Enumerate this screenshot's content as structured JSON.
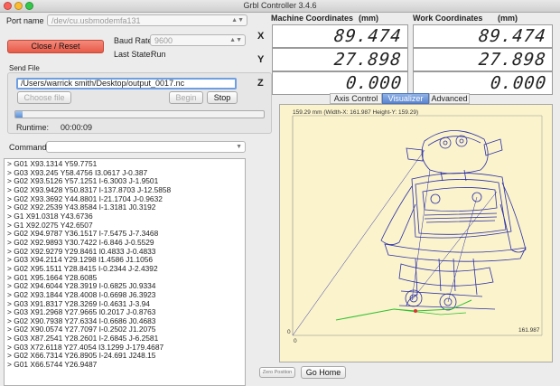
{
  "window": {
    "title": "Grbl Controller 3.4.6"
  },
  "port": {
    "label": "Port name",
    "value": "/dev/cu.usbmodemfa131"
  },
  "close_reset_label": "Close / Reset",
  "baud": {
    "label": "Baud Rate",
    "value": "9600"
  },
  "last_state": {
    "label": "Last State:",
    "value": "Run"
  },
  "send_file": {
    "label": "Send File",
    "path": "/Users/warrick smith/Desktop/output_0017.nc",
    "choose_label": "Choose file",
    "begin_label": "Begin",
    "stop_label": "Stop",
    "progress": 0.03,
    "runtime_label": "Runtime:",
    "runtime_value": "00:00:09"
  },
  "command": {
    "label": "Command",
    "value": ""
  },
  "log": [
    "> G01 X93.1314 Y59.7751",
    "> G03 X93.245 Y58.4756 I3.0617 J-0.387",
    "> G02 X93.5126 Y57.1251 I-6.3003 J-1.9501",
    "> G02 X93.9428 Y50.8317 I-137.8703 J-12.5858",
    "> G02 X93.3692 Y44.8801 I-21.1704 J-0.9632",
    "> G02 X92.2539 Y43.8584 I-1.3181 J0.3192",
    "> G1  X91.0318 Y43.6736",
    "> G1  X92.0275 Y42.6507",
    "> G02 X94.9787 Y36.1517 I-7.5475 J-7.3468",
    "> G02 X92.9893 Y30.7422 I-6.846 J-0.5529",
    "> G02 X92.9279 Y29.8461 I0.4833 J-0.4833",
    "> G03 X94.2114 Y29.1298 I1.4586 J1.1056",
    "> G02 X95.1511 Y28.8415 I-0.2344 J-2.4392",
    "> G01 X95.1664 Y28.6085",
    "> G02 X94.6044 Y28.3919 I-0.6825 J0.9334",
    "> G02 X93.1844 Y28.4008 I-0.6698 J6.3923",
    "> G03 X91.8317 Y28.3269 I-0.4631 J-3.94",
    "> G03 X91.2968 Y27.9665 I0.2017 J-0.8763",
    "> G02 X90.7938 Y27.6334 I-0.6686 J0.4683",
    "> G02 X90.0574 Y27.7097 I-0.2502 J1.2075",
    "> G03 X87.2541 Y28.2601 I-2.6845 J-6.2581",
    "> G03 X72.6118 Y27.4054 I3.1299 J-179.4687",
    "> G02 X66.7314 Y26.8905 I-24.691 J248.15",
    "> G01 X66.5744 Y26.9487"
  ],
  "coords": {
    "machine_header": "Machine Coordinates",
    "work_header": "Work Coordinates",
    "units": "(mm)",
    "axes": [
      {
        "axis": "X",
        "machine": "89.474",
        "work": "89.474"
      },
      {
        "axis": "Y",
        "machine": "27.898",
        "work": "27.898"
      },
      {
        "axis": "Z",
        "machine": "0.000",
        "work": "0.000"
      }
    ]
  },
  "tabs": [
    {
      "label": "Axis Control",
      "active": false
    },
    {
      "label": "Visualizer",
      "active": true
    },
    {
      "label": "Advanced",
      "active": false
    }
  ],
  "visualizer": {
    "header": "159.29 mm  (Width-X: 161.987  Height-Y: 159.29)",
    "x_max_label": "161.987",
    "origin_label_left": "0",
    "origin_label_bottom": "0",
    "zero_position_label": "Zero Position",
    "go_home_label": "Go Home",
    "path_color": "#2a2ea8",
    "tool_color": "#30c030",
    "current_color": "#e03030"
  }
}
